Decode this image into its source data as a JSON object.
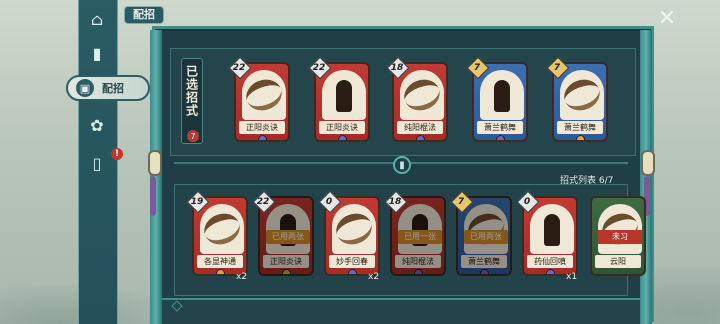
{
  "title": "配招",
  "nav": {
    "active_label": "配招"
  },
  "selected": {
    "label": "已选招式",
    "count": "7",
    "cards": [
      {
        "name": "正阳炎诀",
        "cost": "22",
        "color": "red",
        "gem": "purple"
      },
      {
        "name": "正阳炎诀",
        "cost": "22",
        "color": "red",
        "gem": "purple"
      },
      {
        "name": "纯阳棍法",
        "cost": "18",
        "color": "red",
        "gem": "purple"
      },
      {
        "name": "萧兰鹤舞",
        "cost": "7",
        "color": "blue",
        "gem": "purple"
      },
      {
        "name": "萧兰鹤舞",
        "cost": "7",
        "color": "blue",
        "gem": "gold"
      }
    ]
  },
  "list": {
    "label": "招式列表",
    "count": "6/7",
    "cards": [
      {
        "name": "各显神通",
        "cost": "19",
        "color": "red",
        "gem": "gold",
        "multiplier": "x2",
        "tag": ""
      },
      {
        "name": "正阳炎诀",
        "cost": "22",
        "color": "red",
        "gem": "gold",
        "multiplier": "",
        "tag": "已用两张"
      },
      {
        "name": "妙手回春",
        "cost": "0",
        "color": "red",
        "gem": "purple",
        "multiplier": "x2",
        "tag": ""
      },
      {
        "name": "纯阳棍法",
        "cost": "18",
        "color": "red",
        "gem": "purple",
        "multiplier": "",
        "tag": "已用一张"
      },
      {
        "name": "萧兰鹤舞",
        "cost": "7",
        "color": "blue",
        "gem": "purple",
        "multiplier": "",
        "tag": "已用两张"
      },
      {
        "name": "药仙回嗔",
        "cost": "0",
        "color": "red",
        "gem": "purple",
        "multiplier": "x1",
        "tag": ""
      },
      {
        "name": "云阳",
        "cost": "",
        "color": "green",
        "gem": "",
        "multiplier": "",
        "tag": "未习"
      }
    ]
  }
}
